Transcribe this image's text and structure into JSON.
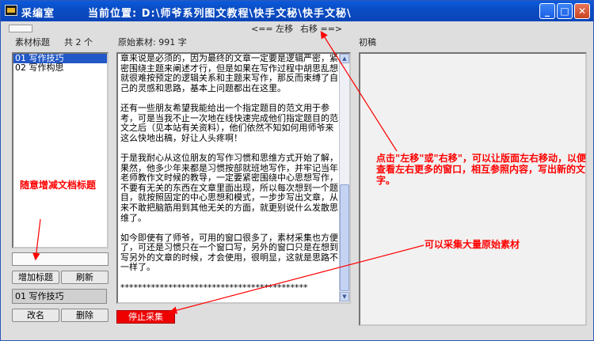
{
  "window": {
    "title": "采编室",
    "path": "当前位置: D:\\师爷系列图文教程\\快手文秘\\快手文秘\\",
    "controls": {
      "minimize": "_",
      "maximize": "□",
      "close": "✕"
    }
  },
  "nav": {
    "left": "<== 左移",
    "right": "右移 ==>"
  },
  "headers": {
    "material_title": "素材标题",
    "count": "共 2 个",
    "raw_material": "原始素材: 991 字",
    "draft": "初稿"
  },
  "title_list": [
    "01 写作技巧",
    "02 写作构思"
  ],
  "buttons": {
    "add_title": "增加标题",
    "refresh": "刷新",
    "rename": "改名",
    "delete": "删除",
    "stop_collect": "停止采集"
  },
  "current_title": "01 写作技巧",
  "editor_text": "章来说是必须的，因为最终的文章一定要是逻辑严密，紧密围绕主题来阐述才行，但是如果在写作过程中胡思乱想就很难按预定的逻辑关系和主题来写作，那反而束缚了自己的灵感和思路，基本上问题都出在这里。\n\n还有一些朋友希望我能给出一个指定题目的范文用于参考，可是当我不止一次地在线快速完成他们指定题目的范文之后（见本站有关资料），他们依然不知如何用师爷来这么快地出稿，好让人头疼啊！\n\n于是我耐心从这位朋友的写作习惯和思维方式开始了解，果然，他多少年来都是习惯按部就班地写作，并牢记当年老师教作文时候的教导，一定要紧密围绕中心思想写作，不要有无关的东西在文章里面出现，所以每次想到一个题目，就按照固定的中心思想和模式，一步步写出文章，从来不敢把脑筋用到其他无关的方面，就更别说什么发散思维了。\n\n如今即使有了师爷，可用的窗口很多了，素材采集也方便了，可还是习惯只在一个窗口写，另外的窗口只是在想到写另外的文章的时候，才会使用，很明显，这就是思路不一样了。\n\n*******************************************",
  "annotations": {
    "title_tip": "随意增减文档标题",
    "move_tip": "点击\"左移\"或\"右移\"，可以让版面左右移动，以便查看左右更多的窗口，相互参照内容，写出新的文字。",
    "collect_tip": "可以采集大量原始素材"
  },
  "colors": {
    "annotation": "#ff0000",
    "selection": "#2358c7",
    "titlebar": "#0a4cc4",
    "stop_button": "#ee0000"
  },
  "icons": [
    "app-icon",
    "minimize-icon",
    "maximize-icon",
    "close-icon",
    "scroll-up-icon",
    "scroll-down-icon"
  ]
}
